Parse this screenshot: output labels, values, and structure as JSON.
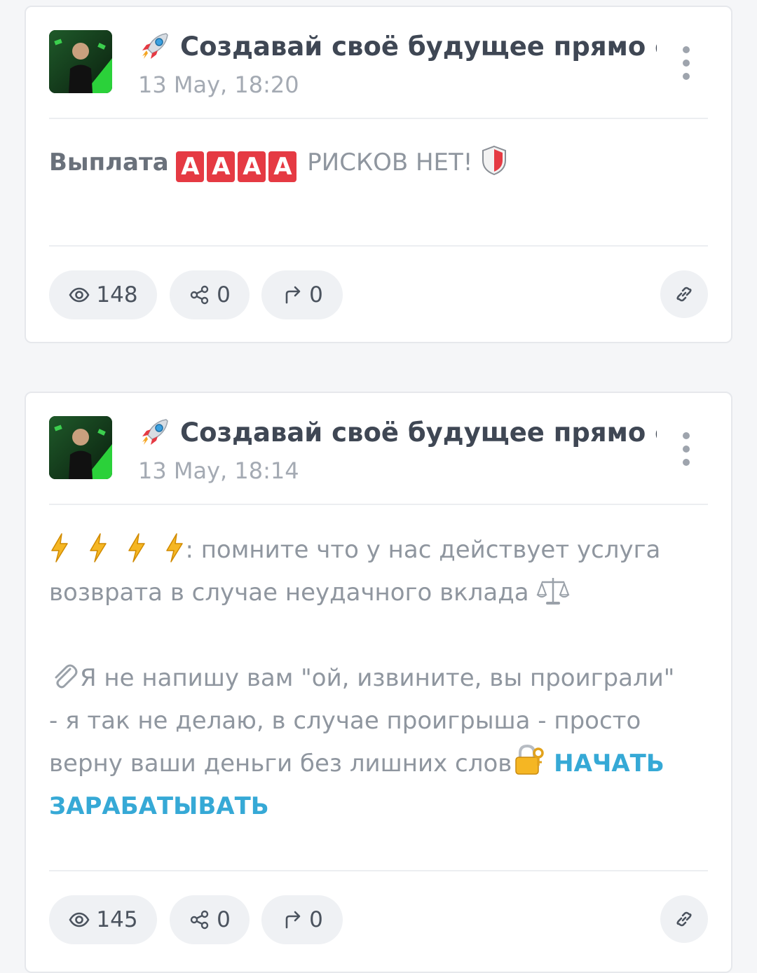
{
  "posts": [
    {
      "channel_title": "Создавай своё будущее прямо сейчас",
      "date": "13 May, 18:20",
      "text_bold": "Выплата",
      "a_boxes": [
        "A",
        "A",
        "A",
        "A"
      ],
      "text_rest": " РИСКОВ НЕТ! ",
      "views": "148",
      "shares": "0",
      "forwards": "0"
    },
    {
      "channel_title": "Создавай своё будущее прямо сейчас",
      "date": "13 May, 18:14",
      "line1": ": помните что у нас действует услуга возврата в случае неудачного вклада ",
      "line2": "Я не напишу вам \"ой, извините, вы проиграли\" - я так не делаю, в случае проигрыша - просто верну ваши деньги без лишних слов",
      "link_text": " НАЧАТЬ ЗАРАБАТЫВАТЬ",
      "views": "145",
      "shares": "0",
      "forwards": "0"
    }
  ],
  "icons": {
    "rocket": "rocket-icon",
    "views": "eye-icon",
    "shares": "share-icon",
    "forwards": "forward-arrow-icon",
    "link": "link-icon",
    "menu": "kebab-menu-icon"
  },
  "colors": {
    "accent_link": "#36a9d6",
    "badge_red": "#e53a43"
  }
}
